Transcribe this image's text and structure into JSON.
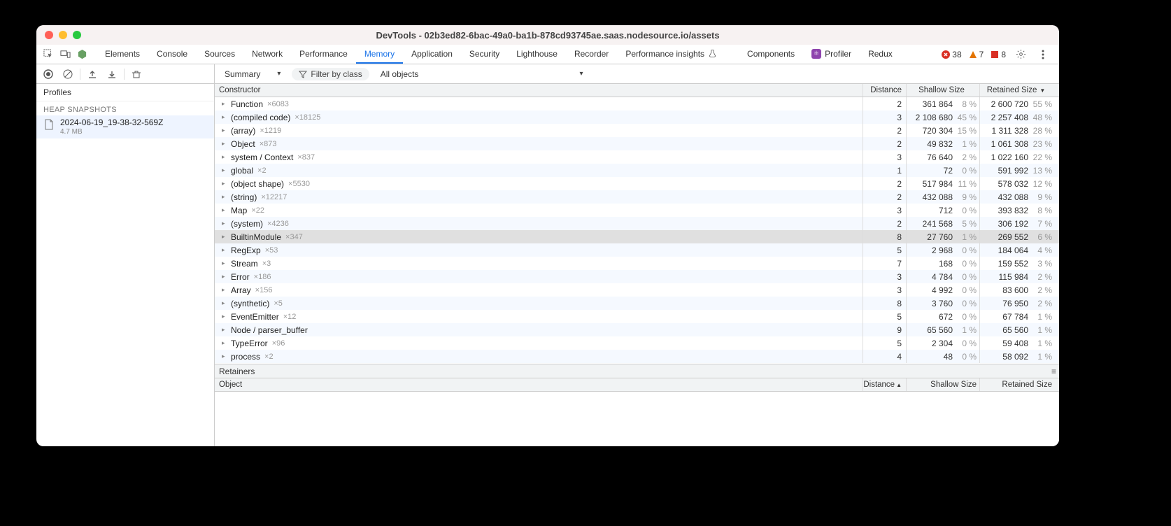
{
  "window": {
    "title": "DevTools - 02b3ed82-6bac-49a0-ba1b-878cd93745ae.saas.nodesource.io/assets"
  },
  "toolbar": {
    "tabs": [
      "Elements",
      "Console",
      "Sources",
      "Network",
      "Performance",
      "Memory",
      "Application",
      "Security",
      "Lighthouse",
      "Recorder",
      "Performance insights"
    ],
    "active_tab": "Memory",
    "ext_tabs": [
      {
        "label": "Components",
        "color": "#8e44ad"
      },
      {
        "label": "Profiler",
        "color": "#8e44ad"
      }
    ],
    "redux_tab": "Redux",
    "errors": "38",
    "warnings": "7",
    "issues": "8"
  },
  "subbar": {
    "summary_label": "Summary",
    "filter_label": "Filter by class",
    "objects_label": "All objects"
  },
  "sidebar": {
    "profiles": "Profiles",
    "section": "HEAP SNAPSHOTS",
    "snap_name": "2024-06-19_19-38-32-569Z",
    "snap_size": "4.7 MB"
  },
  "grid": {
    "headers": {
      "constructor": "Constructor",
      "distance": "Distance",
      "shallow": "Shallow Size",
      "retained": "Retained Size"
    },
    "rows": [
      {
        "name": "Function",
        "count": "×6083",
        "dist": "2",
        "sh": "361 864",
        "shp": "8 %",
        "rt": "2 600 720",
        "rtp": "55 %"
      },
      {
        "name": "(compiled code)",
        "count": "×18125",
        "dist": "3",
        "sh": "2 108 680",
        "shp": "45 %",
        "rt": "2 257 408",
        "rtp": "48 %"
      },
      {
        "name": "(array)",
        "count": "×1219",
        "dist": "2",
        "sh": "720 304",
        "shp": "15 %",
        "rt": "1 311 328",
        "rtp": "28 %"
      },
      {
        "name": "Object",
        "count": "×873",
        "dist": "2",
        "sh": "49 832",
        "shp": "1 %",
        "rt": "1 061 308",
        "rtp": "23 %"
      },
      {
        "name": "system / Context",
        "count": "×837",
        "dist": "3",
        "sh": "76 640",
        "shp": "2 %",
        "rt": "1 022 160",
        "rtp": "22 %"
      },
      {
        "name": "global",
        "count": "×2",
        "dist": "1",
        "sh": "72",
        "shp": "0 %",
        "rt": "591 992",
        "rtp": "13 %"
      },
      {
        "name": "(object shape)",
        "count": "×5530",
        "dist": "2",
        "sh": "517 984",
        "shp": "11 %",
        "rt": "578 032",
        "rtp": "12 %"
      },
      {
        "name": "(string)",
        "count": "×12217",
        "dist": "2",
        "sh": "432 088",
        "shp": "9 %",
        "rt": "432 088",
        "rtp": "9 %"
      },
      {
        "name": "Map",
        "count": "×22",
        "dist": "3",
        "sh": "712",
        "shp": "0 %",
        "rt": "393 832",
        "rtp": "8 %"
      },
      {
        "name": "(system)",
        "count": "×4236",
        "dist": "2",
        "sh": "241 568",
        "shp": "5 %",
        "rt": "306 192",
        "rtp": "7 %"
      },
      {
        "name": "BuiltinModule",
        "count": "×347",
        "dist": "8",
        "sh": "27 760",
        "shp": "1 %",
        "rt": "269 552",
        "rtp": "6 %",
        "selected": true
      },
      {
        "name": "RegExp",
        "count": "×53",
        "dist": "5",
        "sh": "2 968",
        "shp": "0 %",
        "rt": "184 064",
        "rtp": "4 %"
      },
      {
        "name": "Stream",
        "count": "×3",
        "dist": "7",
        "sh": "168",
        "shp": "0 %",
        "rt": "159 552",
        "rtp": "3 %"
      },
      {
        "name": "Error",
        "count": "×186",
        "dist": "3",
        "sh": "4 784",
        "shp": "0 %",
        "rt": "115 984",
        "rtp": "2 %"
      },
      {
        "name": "Array",
        "count": "×156",
        "dist": "3",
        "sh": "4 992",
        "shp": "0 %",
        "rt": "83 600",
        "rtp": "2 %"
      },
      {
        "name": "(synthetic)",
        "count": "×5",
        "dist": "8",
        "sh": "3 760",
        "shp": "0 %",
        "rt": "76 950",
        "rtp": "2 %"
      },
      {
        "name": "EventEmitter",
        "count": "×12",
        "dist": "5",
        "sh": "672",
        "shp": "0 %",
        "rt": "67 784",
        "rtp": "1 %"
      },
      {
        "name": "Node / parser_buffer",
        "count": "",
        "dist": "9",
        "sh": "65 560",
        "shp": "1 %",
        "rt": "65 560",
        "rtp": "1 %"
      },
      {
        "name": "TypeError",
        "count": "×96",
        "dist": "5",
        "sh": "2 304",
        "shp": "0 %",
        "rt": "59 408",
        "rtp": "1 %"
      },
      {
        "name": "process",
        "count": "×2",
        "dist": "4",
        "sh": "48",
        "shp": "0 %",
        "rt": "58 092",
        "rtp": "1 %"
      }
    ]
  },
  "retainers": {
    "title": "Retainers",
    "headers": {
      "object": "Object",
      "distance": "Distance",
      "shallow": "Shallow Size",
      "retained": "Retained Size"
    }
  }
}
